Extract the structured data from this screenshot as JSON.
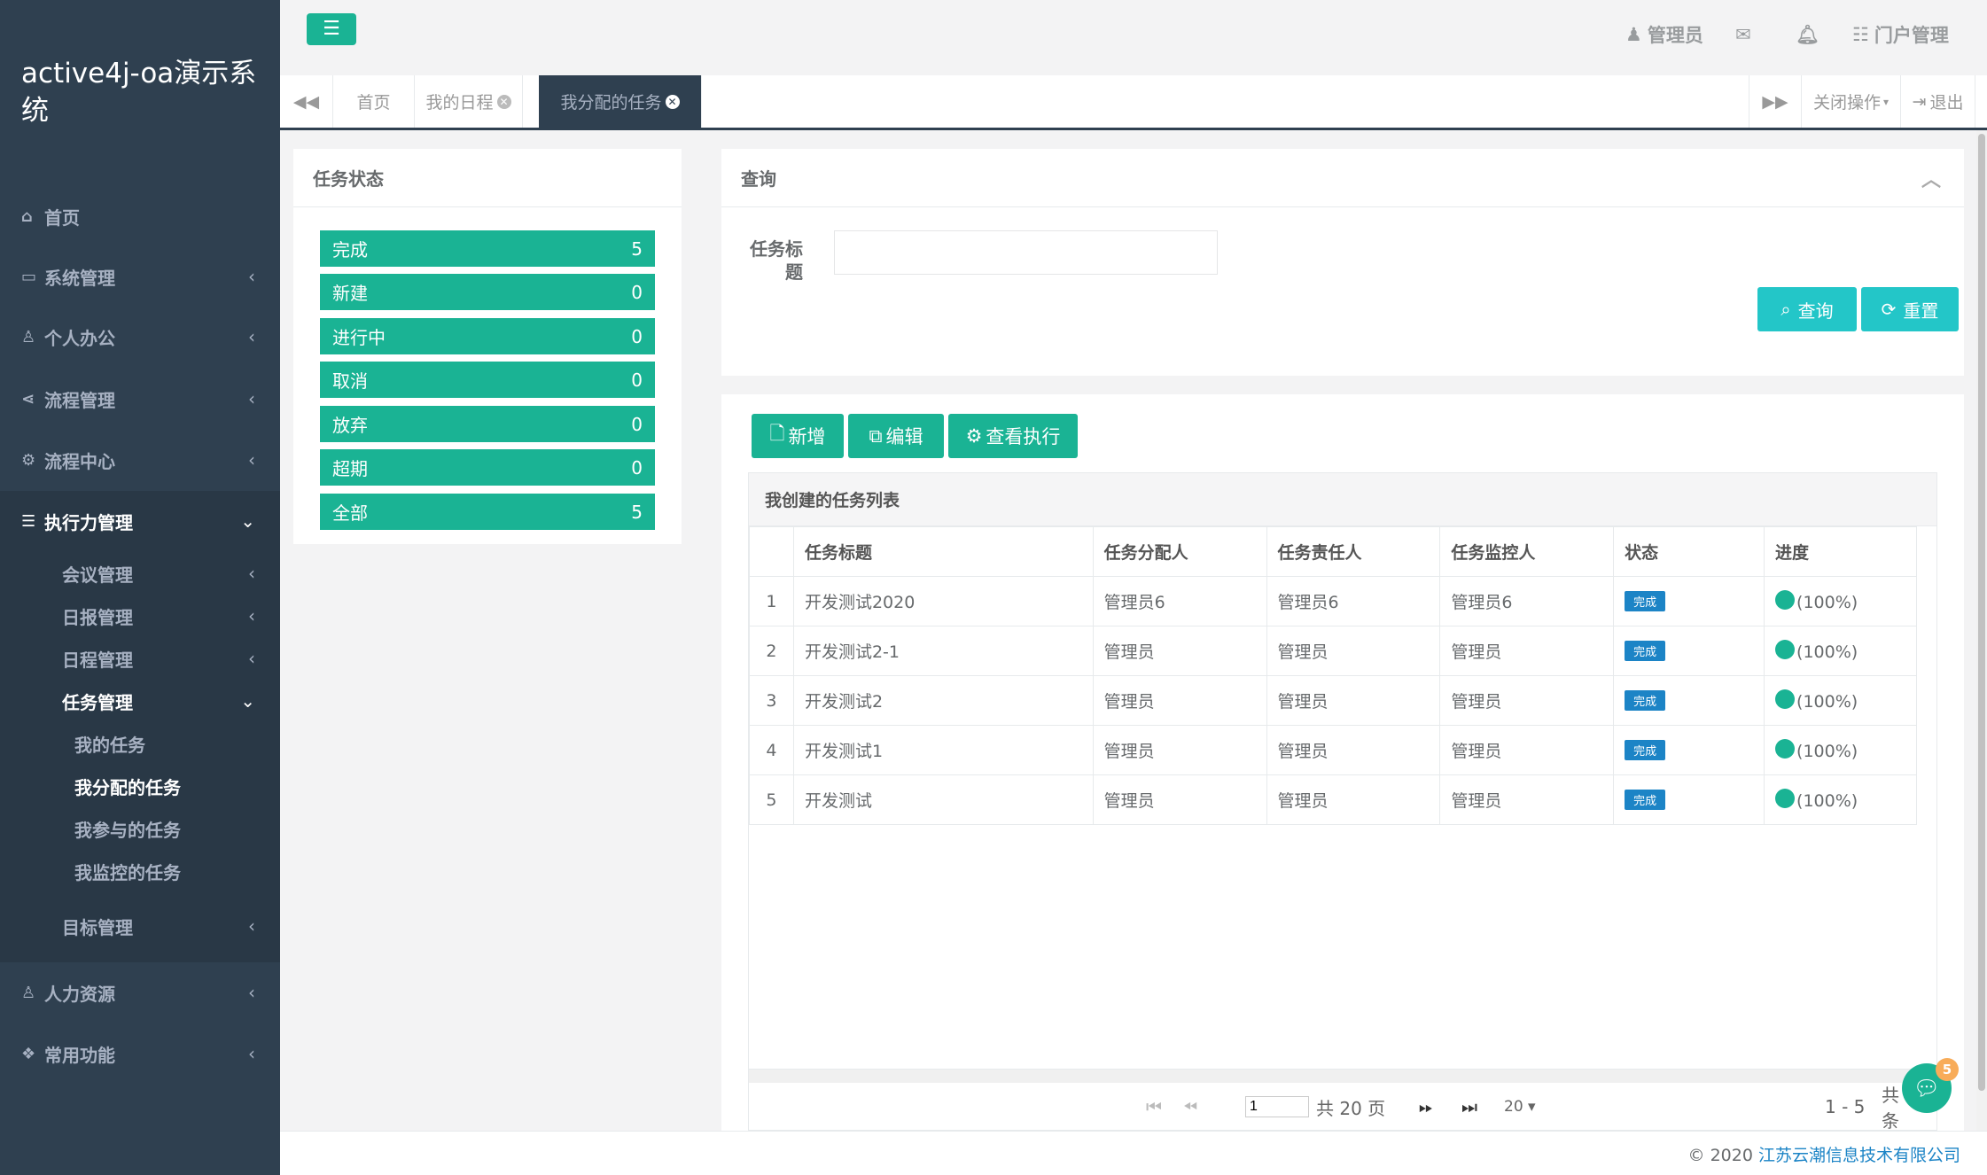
{
  "app": {
    "title": "active4j-oa演示系统"
  },
  "sidebar": {
    "items": [
      {
        "label": "首页",
        "icon": "home-icon"
      },
      {
        "label": "系统管理",
        "icon": "desktop-icon"
      },
      {
        "label": "个人办公",
        "icon": "users-icon"
      },
      {
        "label": "流程管理",
        "icon": "share-icon"
      },
      {
        "label": "流程中心",
        "icon": "gear-icon"
      },
      {
        "label": "执行力管理",
        "icon": "list-icon"
      },
      {
        "label": "人力资源",
        "icon": "user-plus-icon"
      },
      {
        "label": "常用功能",
        "icon": "cubes-icon"
      }
    ],
    "sub_items": [
      "会议管理",
      "日报管理",
      "日程管理",
      "任务管理",
      "目标管理"
    ],
    "task_items": [
      "我的任务",
      "我分配的任务",
      "我参与的任务",
      "我监控的任务"
    ]
  },
  "topbar": {
    "user": "管理员",
    "portal": "门户管理"
  },
  "tabs": {
    "items": [
      "首页",
      "我的日程",
      "我分配的任务"
    ],
    "close_ops": "关闭操作",
    "logout": "退出"
  },
  "status_panel": {
    "title": "任务状态",
    "items": [
      {
        "label": "完成",
        "count": "5"
      },
      {
        "label": "新建",
        "count": "0"
      },
      {
        "label": "进行中",
        "count": "0"
      },
      {
        "label": "取消",
        "count": "0"
      },
      {
        "label": "放弃",
        "count": "0"
      },
      {
        "label": "超期",
        "count": "0"
      },
      {
        "label": "全部",
        "count": "5"
      }
    ]
  },
  "query": {
    "title": "查询",
    "field_label_1": "任务标",
    "field_label_2": "题",
    "field_value": "",
    "search_label": "查询",
    "reset_label": "重置"
  },
  "toolbar": {
    "add_label": "新增",
    "edit_label": "编辑",
    "view_label": "查看执行"
  },
  "grid": {
    "caption": "我创建的任务列表",
    "headers": [
      "任务标题",
      "任务分配人",
      "任务责任人",
      "任务监控人",
      "状态",
      "进度"
    ],
    "rows": [
      {
        "num": "1",
        "title": "开发测试2020",
        "assigner": "管理员6",
        "owner": "管理员6",
        "monitor": "管理员6",
        "status": "完成",
        "progress": "(100%)"
      },
      {
        "num": "2",
        "title": "开发测试2-1",
        "assigner": "管理员",
        "owner": "管理员",
        "monitor": "管理员",
        "status": "完成",
        "progress": "(100%)"
      },
      {
        "num": "3",
        "title": "开发测试2",
        "assigner": "管理员",
        "owner": "管理员",
        "monitor": "管理员",
        "status": "完成",
        "progress": "(100%)"
      },
      {
        "num": "4",
        "title": "开发测试1",
        "assigner": "管理员",
        "owner": "管理员",
        "monitor": "管理员",
        "status": "完成",
        "progress": "(100%)"
      },
      {
        "num": "5",
        "title": "开发测试",
        "assigner": "管理员",
        "owner": "管理员",
        "monitor": "管理员",
        "status": "完成",
        "progress": "(100%)"
      }
    ]
  },
  "pager": {
    "page": "1",
    "total_pages": "共 20 页",
    "page_size": "20",
    "range": "1 - 5",
    "total": "共 5 条"
  },
  "chat": {
    "badge": "5"
  },
  "footer": {
    "copyright": "© 2020",
    "company": "江苏云潮信息技术有限公司",
    "link_color": "#1c84c6"
  },
  "colors": {
    "primary": "#1ab394",
    "info": "#23c6c8",
    "sidebar": "#2f4050",
    "badge": "#1c84c6",
    "chat_badge": "#f8ac59"
  }
}
